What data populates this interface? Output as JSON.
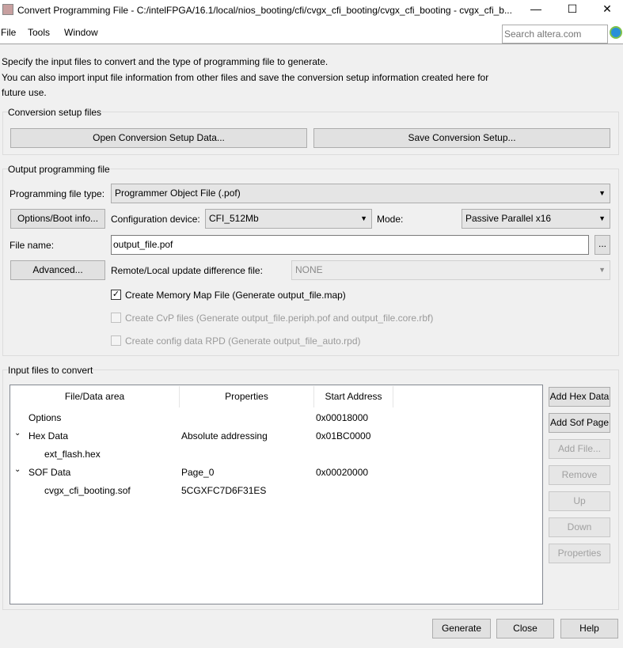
{
  "window": {
    "title": "Convert Programming File - C:/intelFPGA/16.1/local/nios_booting/cfi/cvgx_cfi_booting/cvgx_cfi_booting - cvgx_cfi_b...",
    "minimize": "—",
    "maximize": "☐",
    "close": "✕"
  },
  "menu": {
    "items": [
      "File",
      "Tools",
      "Window"
    ],
    "search_placeholder": "Search altera.com"
  },
  "intro": {
    "line1": "Specify the input files to convert and the type of programming file to generate.",
    "line2": "You can also import input file information from other files and save the conversion setup information created here for",
    "line3": "future use."
  },
  "setup": {
    "title": "Conversion setup files",
    "open": "Open Conversion Setup Data...",
    "save": "Save Conversion Setup..."
  },
  "output": {
    "title": "Output programming file",
    "type_label": "Programming file type:",
    "type_value": "Programmer Object File (.pof)",
    "options_button": "Options/Boot info...",
    "device_label": "Configuration device:",
    "device_value": "CFI_512Mb",
    "mode_label": "Mode:",
    "mode_value": "Passive Parallel x16",
    "filename_label": "File name:",
    "filename_value": "output_file.pof",
    "browse": "...",
    "advanced": "Advanced...",
    "remote_label": "Remote/Local update difference file:",
    "remote_value": "NONE",
    "checkboxes": [
      {
        "label": "Create Memory Map File (Generate output_file.map)",
        "checked": true,
        "enabled": true
      },
      {
        "label": "Create CvP files (Generate output_file.periph.pof and output_file.core.rbf)",
        "checked": false,
        "enabled": false
      },
      {
        "label": "Create config data RPD (Generate output_file_auto.rpd)",
        "checked": false,
        "enabled": false
      }
    ]
  },
  "input": {
    "title": "Input files to convert",
    "columns": [
      "File/Data area",
      "Properties",
      "Start Address"
    ],
    "rows": [
      {
        "name": "Options",
        "props": "",
        "addr": "0x00018000"
      },
      {
        "name": "Hex Data",
        "props": "Absolute addressing",
        "addr": "0x01BC0000"
      },
      {
        "name": "ext_flash.hex",
        "props": "",
        "addr": ""
      },
      {
        "name": "SOF Data",
        "props": "Page_0",
        "addr": "0x00020000"
      },
      {
        "name": "cvgx_cfi_booting.sof",
        "props": "5CGXFC7D6F31ES",
        "addr": ""
      }
    ],
    "buttons": [
      "Add Hex Data",
      "Add Sof Page",
      "Add File...",
      "Remove",
      "Up",
      "Down",
      "Properties"
    ]
  },
  "footer": {
    "generate": "Generate",
    "close": "Close",
    "help": "Help"
  }
}
